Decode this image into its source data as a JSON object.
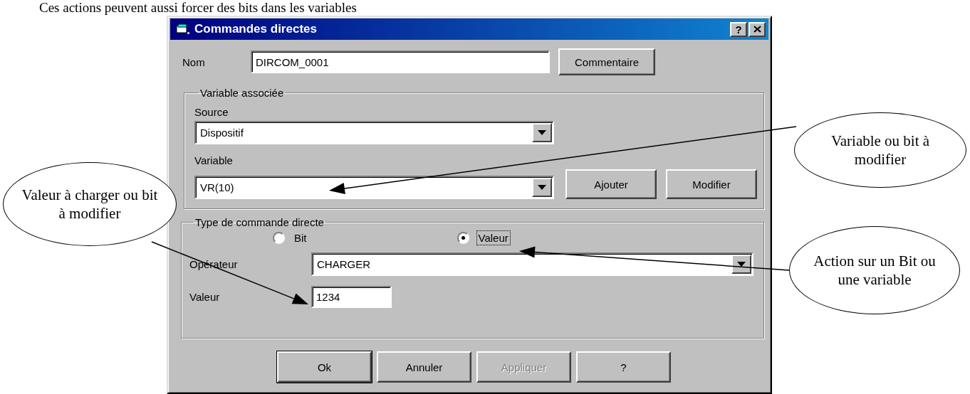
{
  "page_text": "Ces actions peuvent aussi forcer des bits dans les variables",
  "dialog": {
    "title": "Commandes directes",
    "help_button": "?",
    "name_field": {
      "label": "Nom",
      "value": "DIRCOM_0001"
    },
    "comment_button": "Commentaire",
    "variable_group": {
      "legend": "Variable associée",
      "source": {
        "label": "Source",
        "value": "Dispositif"
      },
      "variable": {
        "label": "Variable",
        "value": "VR(10)"
      },
      "buttons": [
        {
          "label": "Ajouter"
        },
        {
          "label": "Modifier"
        }
      ]
    },
    "command_group": {
      "legend": "Type de commande directe",
      "radios": [
        {
          "label": "Bit",
          "selected": false,
          "focused": false
        },
        {
          "label": "Valeur",
          "selected": true,
          "focused": true
        }
      ],
      "operator": {
        "label": "Opérateur",
        "value": "CHARGER"
      },
      "value": {
        "label": "Valeur",
        "value": "1234"
      }
    },
    "buttons": [
      {
        "label": "Ok",
        "default": true,
        "disabled": false
      },
      {
        "label": "Annuler",
        "default": false,
        "disabled": false
      },
      {
        "label": "Appliquer",
        "default": false,
        "disabled": true
      },
      {
        "label": "?",
        "default": false,
        "disabled": false
      }
    ]
  },
  "callouts": [
    {
      "text": "Variable ou bit à modifier"
    },
    {
      "text": "Valeur à charger ou bit à modifier"
    },
    {
      "text": "Action sur un Bit ou une variable"
    }
  ]
}
